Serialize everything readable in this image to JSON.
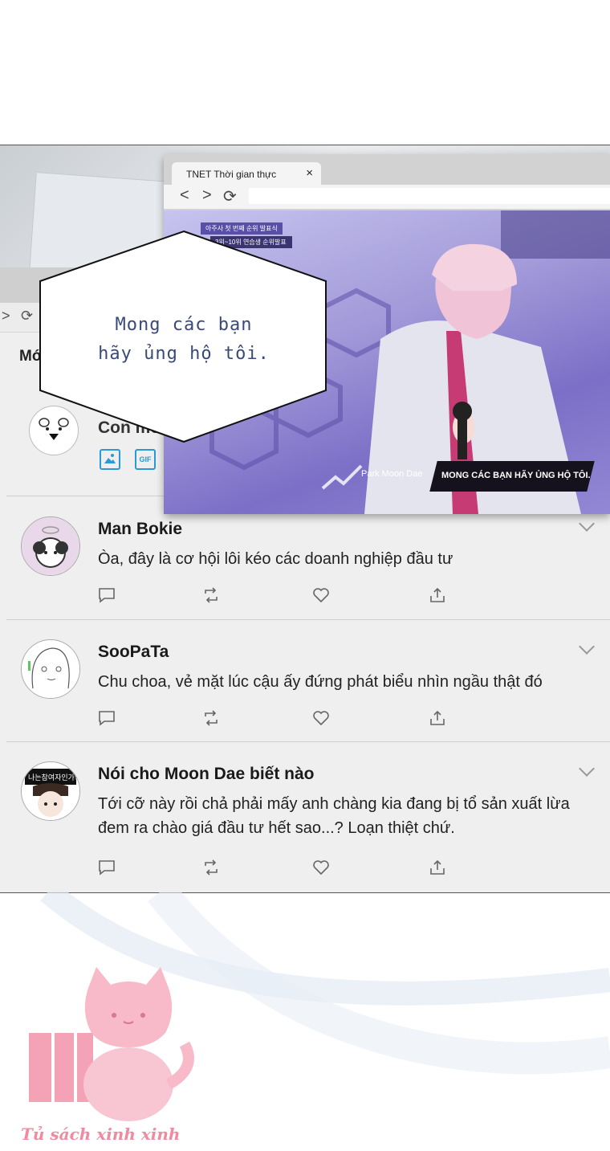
{
  "back_browser": {
    "feed_header": "Mới nhất",
    "composer": {
      "placeholder": "Con mèo",
      "image_icon": "image-icon",
      "gif_label": "GIF"
    },
    "posts": [
      {
        "username": "Man Bokie",
        "text": "Òa, đây là cơ hội lôi kéo các doanh nghiệp đầu tư"
      },
      {
        "username": "SooPaTa",
        "text": "Chu choa, vẻ mặt lúc cậu ấy đứng phát biểu nhìn ngầu thật đó"
      },
      {
        "username": "Nói cho Moon Dae biết nào",
        "text": "Tới cỡ này rồi chả phải mấy anh chàng kia đang bị tổ sản xuất lừa đem ra chào giá đầu tư hết sao...? Loạn thiệt chứ.",
        "avatar_caption": "나는참여자인가봐"
      }
    ],
    "actions": [
      "reply-icon",
      "retweet-icon",
      "like-icon",
      "share-icon"
    ]
  },
  "front_browser": {
    "tab_title": "TNET Thời gian thực",
    "close": "×",
    "nav": {
      "back": "<",
      "forward": ">",
      "reload": "⟳"
    },
    "broadcast": {
      "badge_line1": "아주사 첫 번째 순위 발표식",
      "badge_line2": "3위~10위 연습생 순위발표",
      "lower_third_name": "Park Moon Dae",
      "lower_third_caption": "MONG CÁC BẠN HÃY ỦNG HỘ TÔI."
    }
  },
  "speech_bubble": {
    "line1": "Mong các bạn",
    "line2": "hãy ủng hộ tôi."
  },
  "watermark": {
    "text": "Tủ sách xinh xinh"
  },
  "colors": {
    "accent": "#2a9ad6",
    "bubble_text": "#3a4a78",
    "watermark": "#f08aa0"
  }
}
